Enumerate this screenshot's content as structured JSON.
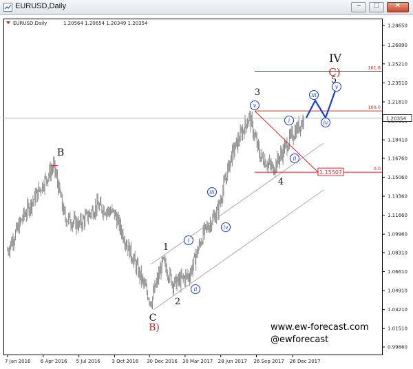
{
  "window": {
    "title": "EURUSD,Daily",
    "buttons": {
      "minimize": "–",
      "maximize": "□",
      "close": "×"
    }
  },
  "chart_header": {
    "symbol": "EURUSD,Daily",
    "ohlc": "1.20564 1.20654 1.20349 1.20354"
  },
  "colors": {
    "candles": "#8a8a8a",
    "wave_circle": "#1f3fc8",
    "fib_line": "#e02020",
    "trend_channel": "#aaaaaa",
    "projection": "#1a3ad8",
    "correction_label": "#d02020"
  },
  "chart_data": {
    "type": "candlestick",
    "x_tick_labels": [
      "7 Jan 2016",
      "6 Apr 2016",
      "5 Jul 2016",
      "3 Oct 2016",
      "30 Dec 2016",
      "30 Mar 2017",
      "28 Jun 2017",
      "26 Sep 2017",
      "26 Dec 2017"
    ],
    "y_tick_labels": [
      "1.28650",
      "1.26890",
      "1.25210",
      "1.23510",
      "1.21810",
      "1.20110",
      "1.18410",
      "1.16760",
      "1.15060",
      "1.13360",
      "1.11660",
      "1.09960",
      "1.08310",
      "1.06610",
      "1.04910",
      "1.03210",
      "1.01510",
      "0.99860"
    ],
    "ylim": [
      0.9986,
      1.2865
    ],
    "current_price": "1.20354",
    "fibonacci_levels": [
      {
        "label": "161.8",
        "price": 1.2455
      },
      {
        "label": "100.0",
        "price": 1.21
      },
      {
        "label": "0.0",
        "price": 1.1551
      }
    ],
    "fib_low_label": "1.15507",
    "approx_closes": [
      {
        "date": "2016-01-07",
        "close": 1.085
      },
      {
        "date": "2016-02-15",
        "close": 1.115
      },
      {
        "date": "2016-03-20",
        "close": 1.135
      },
      {
        "date": "2016-05-03",
        "close": 1.161
      },
      {
        "date": "2016-05-30",
        "close": 1.115
      },
      {
        "date": "2016-07-05",
        "close": 1.108
      },
      {
        "date": "2016-08-20",
        "close": 1.125
      },
      {
        "date": "2016-10-03",
        "close": 1.118
      },
      {
        "date": "2016-11-10",
        "close": 1.085
      },
      {
        "date": "2017-01-03",
        "close": 1.039
      },
      {
        "date": "2017-02-02",
        "close": 1.075
      },
      {
        "date": "2017-03-01",
        "close": 1.055
      },
      {
        "date": "2017-04-10",
        "close": 1.063
      },
      {
        "date": "2017-05-15",
        "close": 1.1
      },
      {
        "date": "2017-06-20",
        "close": 1.12
      },
      {
        "date": "2017-07-25",
        "close": 1.17
      },
      {
        "date": "2017-09-08",
        "close": 1.205
      },
      {
        "date": "2017-10-05",
        "close": 1.17
      },
      {
        "date": "2017-11-07",
        "close": 1.158
      },
      {
        "date": "2017-12-20",
        "close": 1.185
      },
      {
        "date": "2018-01-25",
        "close": 1.2035
      }
    ]
  },
  "wave_labels": {
    "B": "B",
    "C": "C",
    "B_paren": "B)",
    "w1": "1",
    "w2": "2",
    "w3": "3",
    "w4": "4",
    "w5": "5",
    "IV": "IV",
    "C_paren": "C)",
    "sub_i_first": "i",
    "sub_ii_first": "ii",
    "sub_iii_first": "iii",
    "sub_iv_first": "iv",
    "sub_v_first": "v",
    "sub_i_second": "i",
    "sub_ii_second": "ii",
    "sub_iii_proj": "iii",
    "sub_iv_proj": "iv",
    "sub_v_proj": "v"
  },
  "watermark": {
    "site": "www.ew-forecast.com",
    "handle": "@ewforecast"
  }
}
